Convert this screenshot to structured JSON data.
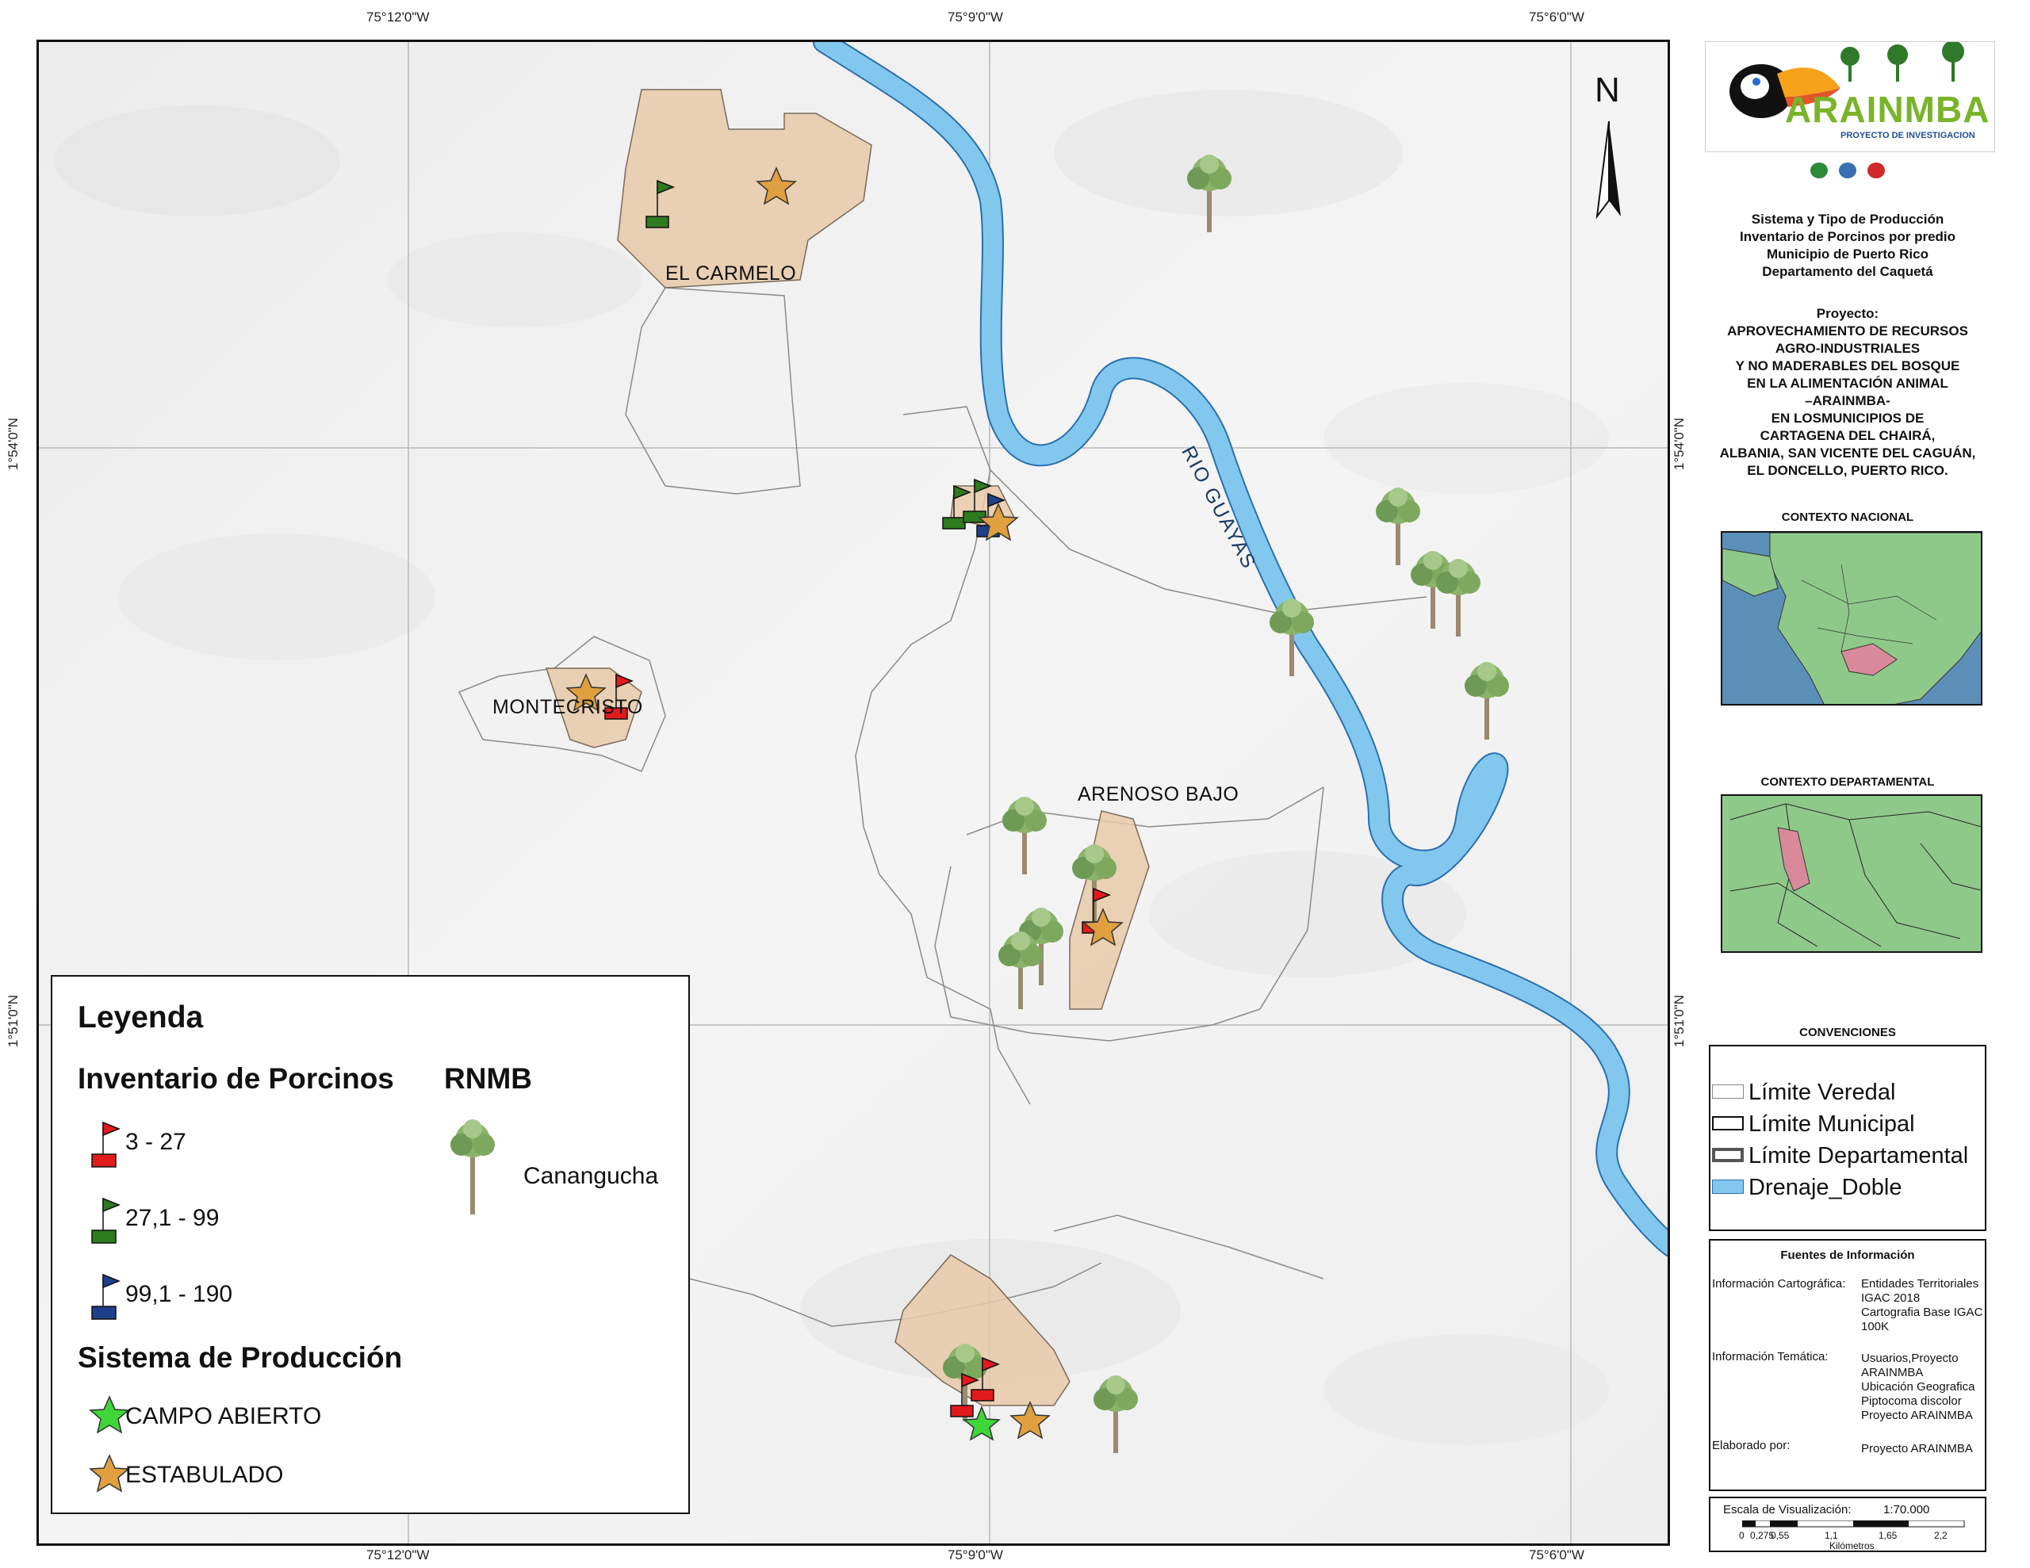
{
  "coordinates": {
    "top": [
      "75°12'0\"W",
      "75°9'0\"W",
      "75°6'0\"W"
    ],
    "bottom": [
      "75°12'0\"W",
      "75°9'0\"W",
      "75°6'0\"W"
    ],
    "left": [
      "1°54'0\"N",
      "1°51'0\"N"
    ],
    "right": [
      "1°54'0\"N",
      "1°51'0\"N"
    ]
  },
  "north_arrow": "N",
  "map_labels": {
    "veredas": [
      "EL CARMELO",
      "MONTECRISTO",
      "ARENOSO BAJO"
    ],
    "river": "RIO GUAYAS"
  },
  "legend": {
    "title": "Leyenda",
    "inventory_title": "Inventario de Porcinos",
    "inventory_items": [
      {
        "label": "3 - 27",
        "color": "#e31a1c"
      },
      {
        "label": "27,1 - 99",
        "color": "#2d7a1f"
      },
      {
        "label": "99,1 - 190",
        "color": "#1f3f8a"
      }
    ],
    "rnmb_title": "RNMB",
    "rnmb_item": "Canangucha",
    "production_title": "Sistema de Producción",
    "production_items": [
      {
        "label": "CAMPO ABIERTO",
        "color": "#3ed63a"
      },
      {
        "label": "ESTABULADO",
        "color": "#e0a040"
      }
    ]
  },
  "panel": {
    "logo_text": "ARAINMBA",
    "logo_subtitle": "PROYECTO DE INVESTIGACION",
    "map_title": [
      "Sistema y Tipo de Producción",
      "Inventario de Porcinos por predio",
      "Municipio de Puerto Rico",
      "Departamento del Caquetá"
    ],
    "project_lines": [
      "Proyecto:",
      "APROVECHAMIENTO DE RECURSOS",
      "AGRO-INDUSTRIALES",
      "Y NO MADERABLES DEL BOSQUE",
      "EN LA ALIMENTACIÓN ANIMAL",
      "–ARAINMBA-",
      "EN LOSMUNICIPIOS DE",
      "CARTAGENA DEL CHAIRÁ,",
      "ALBANIA, SAN VICENTE DEL CAGUÁN,",
      "EL DONCELLO, PUERTO RICO."
    ],
    "contexto_nacional": "CONTEXTO NACIONAL",
    "contexto_departamental": "CONTEXTO DEPARTAMENTAL",
    "convenciones_title": "CONVENCIONES",
    "convenciones": [
      {
        "label": "Límite Veredal"
      },
      {
        "label": "Límite Municipal"
      },
      {
        "label": "Límite Departamental"
      },
      {
        "label": "Drenaje_Doble"
      }
    ],
    "fuentes_title": "Fuentes de Información",
    "fuentes": {
      "cartografica_label": "Información Cartográfica:",
      "cartografica_lines": [
        "Entidades Territoriales",
        "IGAC 2018",
        "Cartografia Base IGAC",
        "100K"
      ],
      "tematica_label": "Información Temática:",
      "tematica_lines": [
        "Usuarios,Proyecto",
        "ARAINMBA",
        "Ubicación Geografica",
        "Piptocoma discolor",
        "Proyecto ARAINMBA"
      ],
      "elaborado_label": "Elaborado por:",
      "elaborado_value": "Proyecto ARAINMBA"
    },
    "escala_label": "Escala de Visualización:",
    "escala_value": "1:70.000",
    "scale_ticks": [
      "0",
      "0,275",
      "0,55",
      "1,1",
      "1,65",
      "2,2"
    ],
    "scale_unit": "Kilómetros"
  },
  "colors": {
    "veredas_fill": "#e8c9a8",
    "river": "#82c8ee",
    "river_stroke": "#2a6fb0",
    "inset_water": "#5b8fb8",
    "inset_land": "#8fc98a",
    "highlight": "#d98a9a"
  }
}
